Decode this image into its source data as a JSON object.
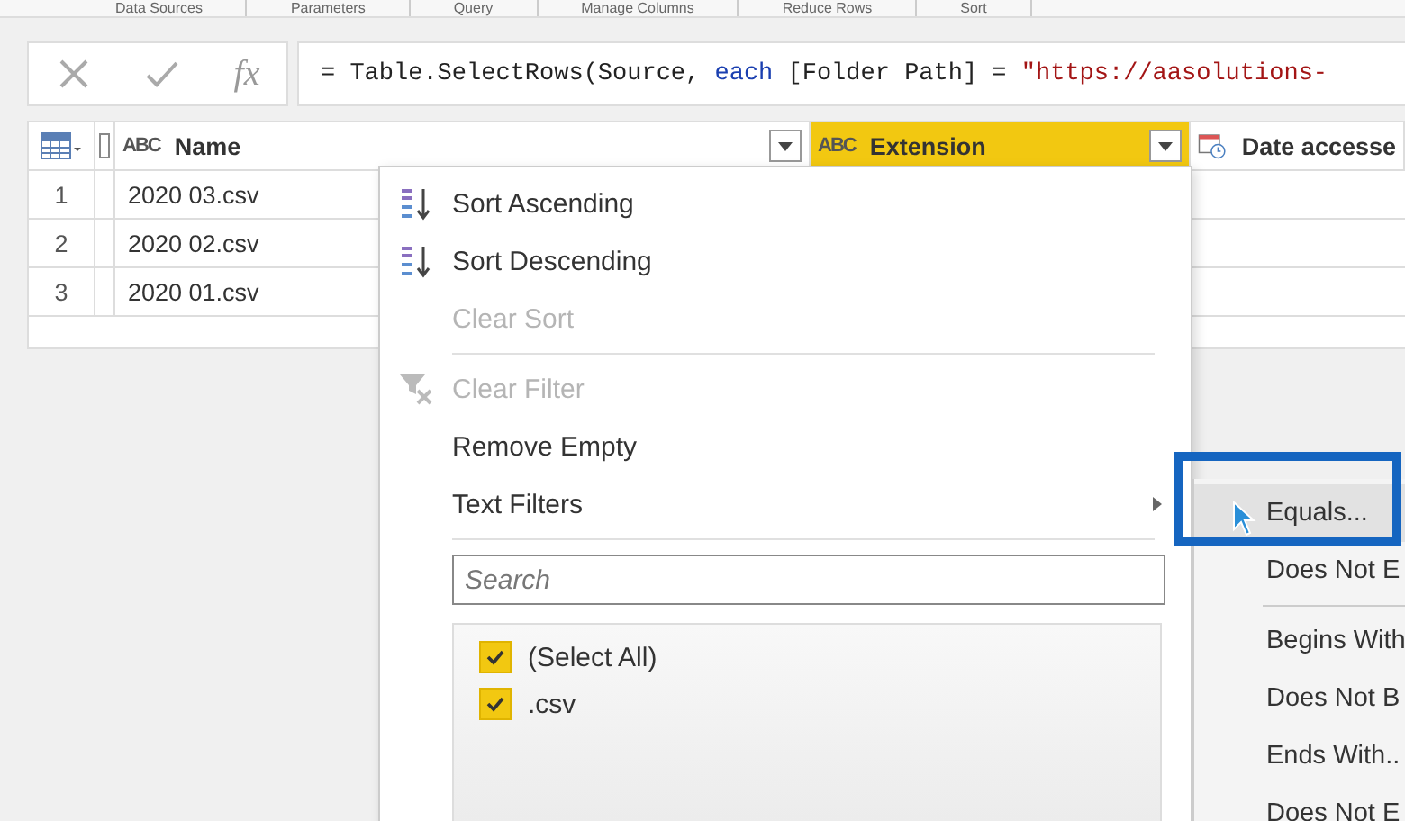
{
  "ribbon_groups": [
    "Data Sources",
    "Parameters",
    "Query",
    "Manage Columns",
    "Reduce Rows",
    "Sort"
  ],
  "formula_bar": {
    "fx": "fx",
    "formula": [
      {
        "kind": "plain",
        "text": "= Table.SelectRows(Source, "
      },
      {
        "kind": "keyword",
        "text": "each"
      },
      {
        "kind": "plain",
        "text": " [Folder Path] = "
      },
      {
        "kind": "string",
        "text": "\"https://aasolutions-"
      }
    ]
  },
  "table": {
    "columns": [
      {
        "name": "Name",
        "type_label": "ABC",
        "selected": false
      },
      {
        "name": "Extension",
        "type_label": "ABC",
        "selected": true
      },
      {
        "name": "Date accesse",
        "selected": false
      }
    ],
    "rows": [
      {
        "index": "1",
        "name": "2020 03.csv"
      },
      {
        "index": "2",
        "name": "2020 02.csv"
      },
      {
        "index": "3",
        "name": "2020 01.csv"
      }
    ]
  },
  "filter_menu": {
    "items": [
      {
        "kind": "item",
        "label": "Sort Ascending",
        "disabled": false
      },
      {
        "kind": "item",
        "label": "Sort Descending",
        "disabled": false
      },
      {
        "kind": "item",
        "label": "Clear Sort",
        "disabled": true
      },
      {
        "kind": "separator"
      },
      {
        "kind": "item",
        "label": "Clear Filter",
        "disabled": true
      },
      {
        "kind": "item",
        "label": "Remove Empty",
        "disabled": false
      },
      {
        "kind": "submenu",
        "label": "Text Filters",
        "disabled": false
      },
      {
        "kind": "separator"
      }
    ],
    "search": {
      "placeholder": "Search"
    },
    "values": [
      {
        "label": "(Select All)",
        "checked": true
      },
      {
        "label": ".csv",
        "checked": true
      }
    ]
  },
  "text_filters_submenu": {
    "items": [
      {
        "kind": "item",
        "label": "Equals...",
        "selected": true
      },
      {
        "kind": "item",
        "label": "Does Not E",
        "selected": false
      },
      {
        "kind": "separator"
      },
      {
        "kind": "item",
        "label": "Begins With",
        "selected": false
      },
      {
        "kind": "item",
        "label": "Does Not B",
        "selected": false
      },
      {
        "kind": "item",
        "label": "Ends With..",
        "selected": false
      },
      {
        "kind": "item",
        "label": "Does Not E",
        "selected": false
      }
    ]
  }
}
